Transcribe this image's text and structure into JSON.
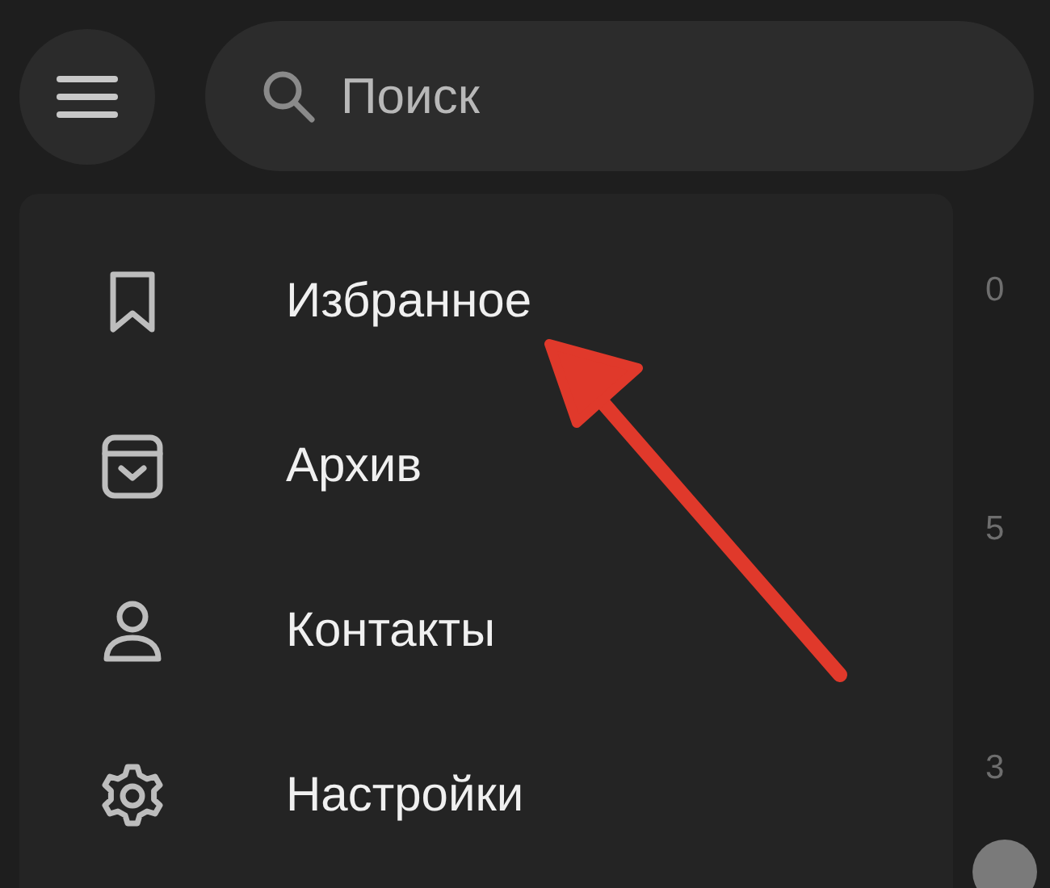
{
  "search": {
    "placeholder": "Поиск"
  },
  "menu": {
    "items": [
      {
        "label": "Избранное",
        "kind": "bookmark"
      },
      {
        "label": "Архив",
        "kind": "archive"
      },
      {
        "label": "Контакты",
        "kind": "person"
      },
      {
        "label": "Настройки",
        "kind": "gear"
      }
    ]
  },
  "chat_list_counts": [
    "0",
    "5",
    "3"
  ]
}
